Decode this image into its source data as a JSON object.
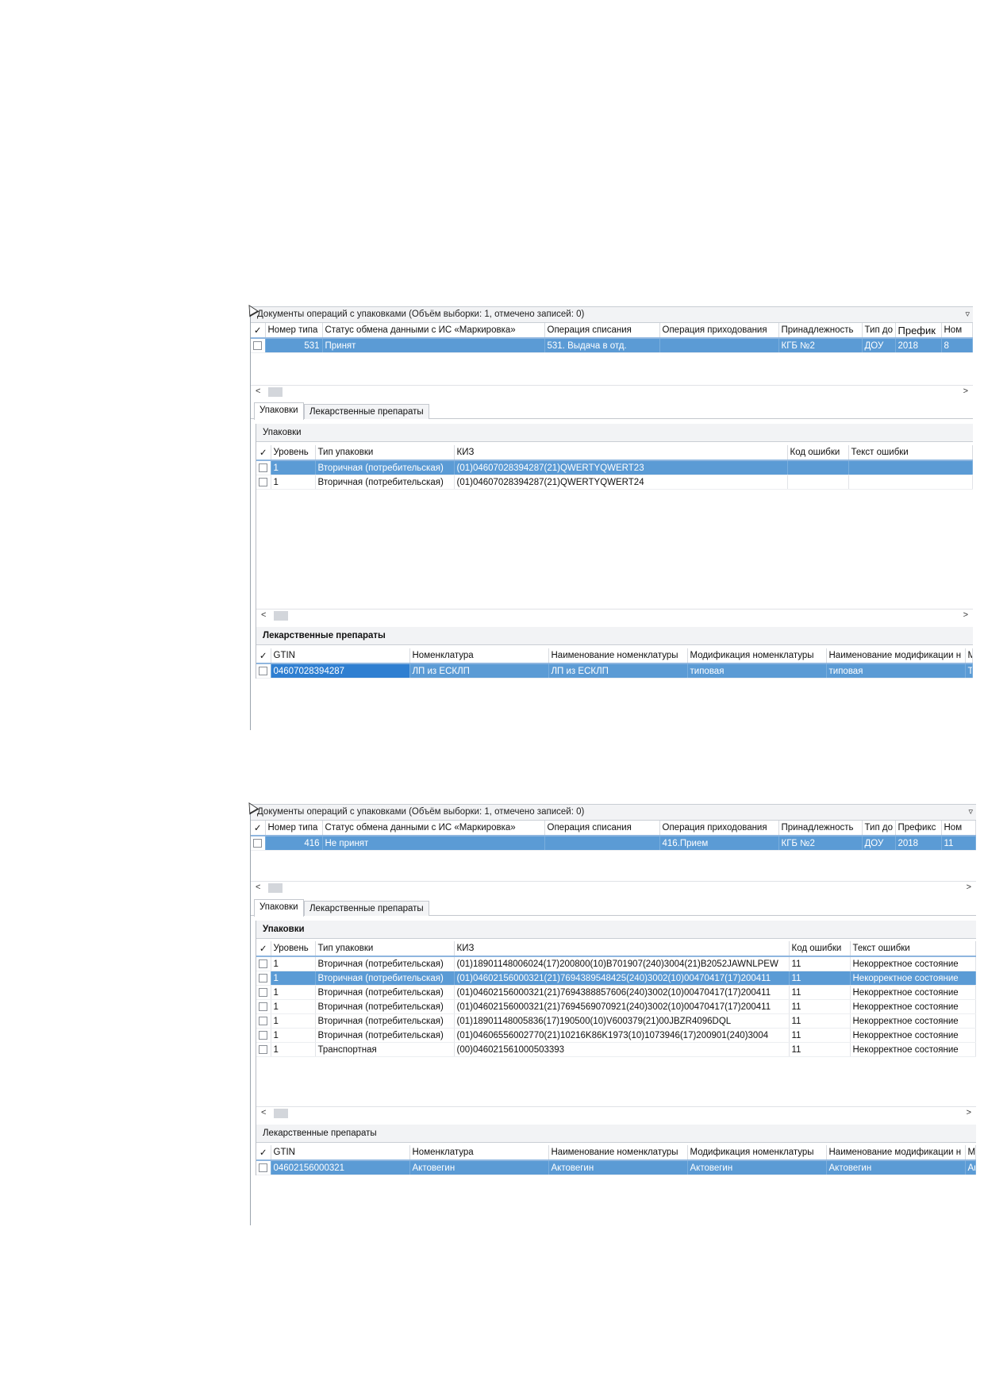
{
  "panels": [
    {
      "header_title": "Документы операций с упаковками (Объём выборки: 1, отмечено записей: 0)",
      "doc_columns": [
        "✓",
        "Номер типа",
        "Статус обмена данными с ИС «Маркировка»",
        "Операция списания",
        "Операция приходования",
        "Принадлежность",
        "Тип до",
        "Префик",
        "Ном"
      ],
      "doc_rows": [
        {
          "type_num": "531",
          "status": "Принят",
          "writeoff": "531. Выдача в отд.",
          "income": "",
          "owner": "КГБ №2",
          "doc_type": "ДОУ",
          "prefix": "2018",
          "num": "8"
        }
      ],
      "tabs": [
        "Упаковки",
        "Лекарственные препараты"
      ],
      "packages_title": "Упаковки",
      "package_columns": [
        "✓",
        "Уровень",
        "Тип упаковки",
        "КИЗ",
        "Код ошибки",
        "Текст ошибки"
      ],
      "package_rows": [
        {
          "level": "1",
          "type": "Вторичная (потребительская)",
          "kiz": "(01)04607028394287(21)QWERTYQWERT23",
          "err_code": "",
          "err_text": ""
        },
        {
          "level": "1",
          "type": "Вторичная (потребительская)",
          "kiz": "(01)04607028394287(21)QWERTYQWERT24",
          "err_code": "",
          "err_text": ""
        }
      ],
      "drugs_title": "Лекарственные препараты",
      "drug_columns": [
        "✓",
        "GTIN",
        "Номенклатура",
        "Наименование номенклатуры",
        "Модификация номенклатуры",
        "Наименование модификации н",
        "Мо"
      ],
      "drug_rows": [
        {
          "gtin": "04607028394287",
          "nom": "ЛП из ЕСКЛП",
          "nom_name": "ЛП из ЕСКЛП",
          "mod": "типовая",
          "mod_name": "типовая",
          "extra": "ТР"
        }
      ]
    },
    {
      "header_title": "Документы операций с упаковками (Объём выборки: 1, отмечено записей: 0)",
      "doc_columns": [
        "✓",
        "Номер типа",
        "Статус обмена данными с ИС «Маркировка»",
        "Операция списания",
        "Операция приходования",
        "Принадлежность",
        "Тип до",
        "Префикс",
        "Ном"
      ],
      "doc_rows": [
        {
          "type_num": "416",
          "status": "Не принят",
          "writeoff": "",
          "income": "416.Прием",
          "owner": "КГБ №2",
          "doc_type": "ДОУ",
          "prefix": "2018",
          "num": "11"
        }
      ],
      "tabs": [
        "Упаковки",
        "Лекарственные препараты"
      ],
      "packages_title": "Упаковки",
      "package_columns": [
        "✓",
        "Уровень",
        "Тип упаковки",
        "КИЗ",
        "Код ошибки",
        "Текст ошибки"
      ],
      "package_rows": [
        {
          "level": "1",
          "type": "Вторичная (потребительская)",
          "kiz": "(01)18901148006024(17)200800(10)B701907(240)3004(21)B2052JAWNLPEW",
          "err_code": "11",
          "err_text": "Некорректное состояние"
        },
        {
          "level": "1",
          "type": "Вторичная (потребительская)",
          "kiz": "(01)04602156000321(21)7694389548425(240)3002(10)00470417(17)200411",
          "err_code": "11",
          "err_text": "Некорректное состояние"
        },
        {
          "level": "1",
          "type": "Вторичная (потребительская)",
          "kiz": "(01)04602156000321(21)7694388857606(240)3002(10)00470417(17)200411",
          "err_code": "11",
          "err_text": "Некорректное состояние"
        },
        {
          "level": "1",
          "type": "Вторичная (потребительская)",
          "kiz": "(01)04602156000321(21)7694569070921(240)3002(10)00470417(17)200411",
          "err_code": "11",
          "err_text": "Некорректное состояние"
        },
        {
          "level": "1",
          "type": "Вторичная (потребительская)",
          "kiz": "(01)18901148005836(17)190500(10)V600379(21)00JBZR4096DQL",
          "err_code": "11",
          "err_text": "Некорректное состояние"
        },
        {
          "level": "1",
          "type": "Вторичная (потребительская)",
          "kiz": "(01)04606556002770(21)10216K86K1973(10)1073946(17)200901(240)3004",
          "err_code": "11",
          "err_text": "Некорректное состояние"
        },
        {
          "level": "1",
          "type": "Транспортная",
          "kiz": "(00)046021561000503393",
          "err_code": "11",
          "err_text": "Некорректное состояние"
        }
      ],
      "drugs_title": "Лекарственные препараты",
      "drug_columns": [
        "✓",
        "GTIN",
        "Номенклатура",
        "Наименование номенклатуры",
        "Модификация номенклатуры",
        "Наименование модификации н",
        "Мо"
      ],
      "drug_rows": [
        {
          "gtin": "04602156000321",
          "nom": "Актовегин",
          "nom_name": "Актовегин",
          "mod": "Актовегин",
          "mod_name": "Актовегин",
          "extra": "Ак"
        }
      ]
    }
  ],
  "scroll": {
    "left": "<",
    "right": ">"
  },
  "icons": {
    "filter": "filter-icon",
    "cursor": "cursor-icon"
  }
}
